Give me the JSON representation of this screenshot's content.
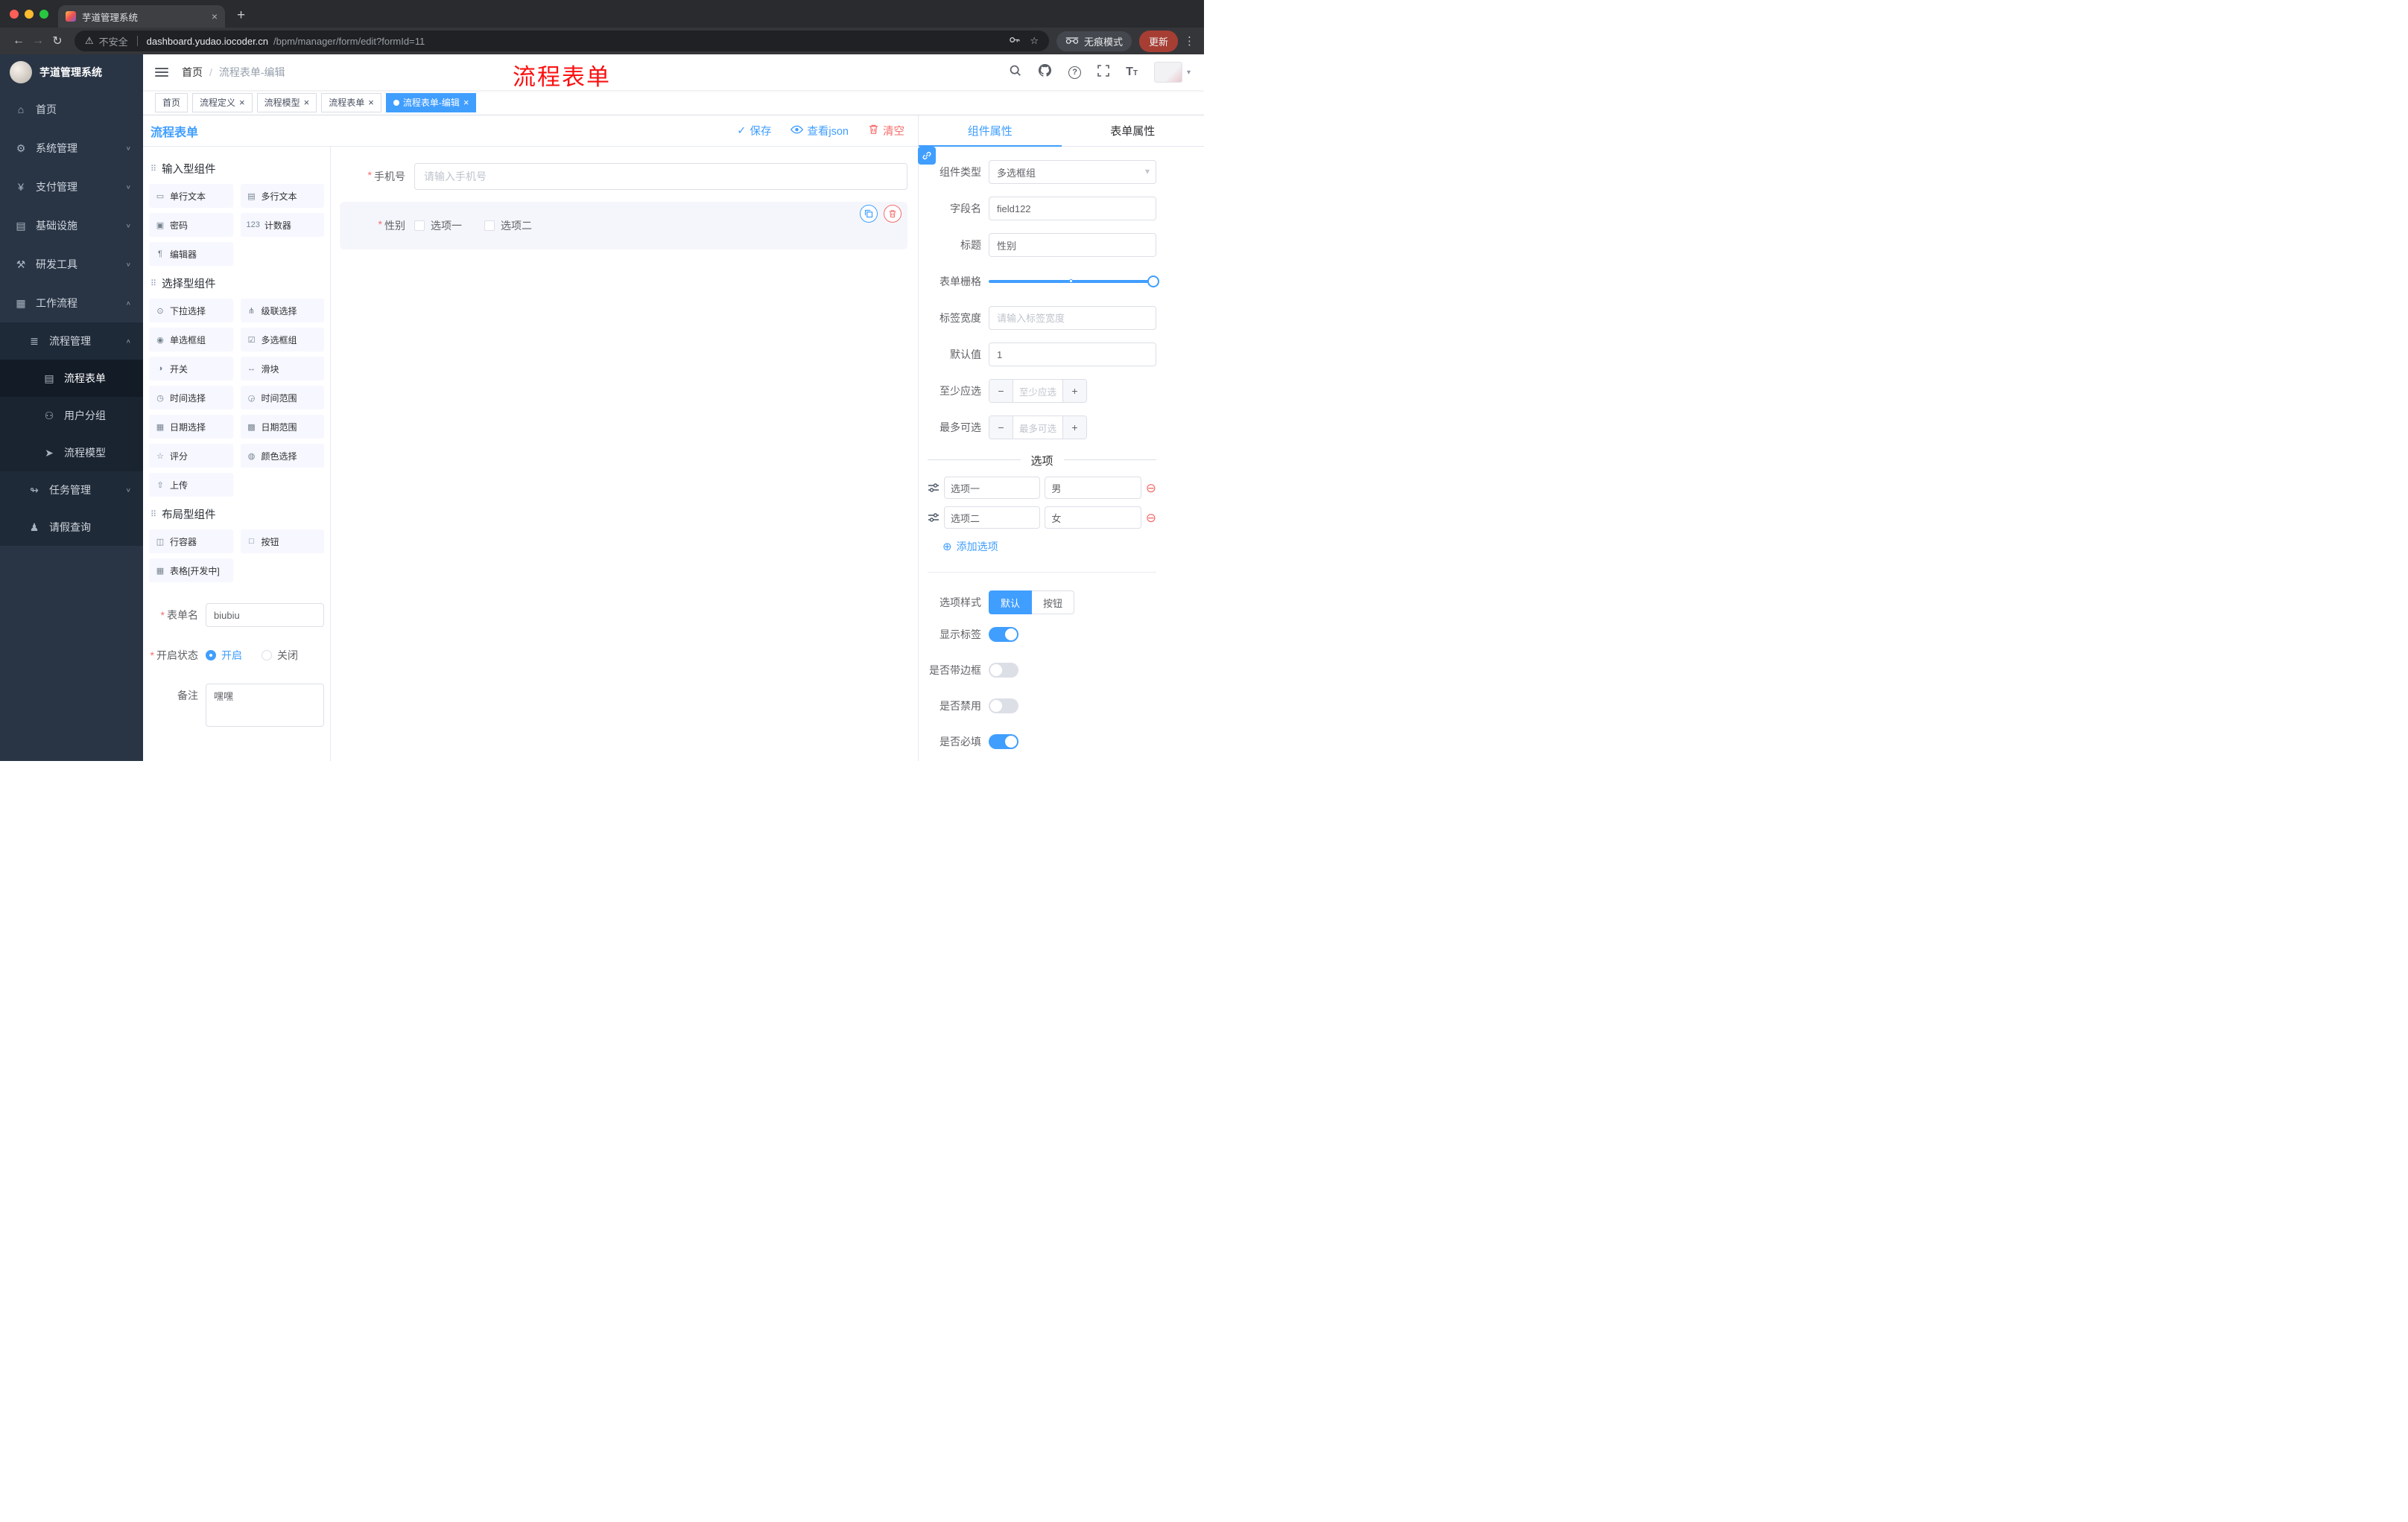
{
  "ui": {
    "required_glyph": "*",
    "close_glyph": "×",
    "caret_down": "▾",
    "check_glyph": "✓",
    "new_tab_glyph": "+",
    "back_glyph": "←",
    "forward_glyph": "→",
    "reload_glyph": "↻",
    "warning_glyph": "⚠",
    "bookmark_star_glyph": "☆",
    "menu_dots_glyph": "⋮",
    "breadcrumb_separator": "/",
    "help_glyph": "?",
    "font_size_glyph_large": "T",
    "font_size_glyph_small": "T",
    "stepper_minus_glyph": "−",
    "stepper_plus_glyph": "+",
    "add_circle_glyph": "⊕",
    "remove_circle_glyph": "⊖",
    "group_drag_glyph": "⠿"
  },
  "colors": {
    "primary": "#409EFF",
    "danger": "#F56C6C",
    "annotation_red": "#FB1010",
    "active_tag": "#409EFF",
    "sidebar_bg": "#293545"
  },
  "browser": {
    "tab_title": "芋道管理系统",
    "security_warning": "不安全",
    "url_host": "dashboard.yudao.iocoder.cn",
    "url_path": "/bpm/manager/form/edit?formId=11",
    "incognito_label": "无痕模式",
    "update_label": "更新"
  },
  "sidebar": {
    "logo_title": "芋道管理系统",
    "items": [
      {
        "label": "首页",
        "glyph": "⌂",
        "arrow": ""
      },
      {
        "label": "系统管理",
        "glyph": "⚙",
        "arrow": "∨"
      },
      {
        "label": "支付管理",
        "glyph": "¥",
        "arrow": "∨"
      },
      {
        "label": "基础设施",
        "glyph": "▤",
        "arrow": "∨"
      },
      {
        "label": "研发工具",
        "glyph": "⚒",
        "arrow": "∨"
      },
      {
        "label": "工作流程",
        "glyph": "▦",
        "arrow": "∧"
      }
    ],
    "process_mgmt": {
      "label": "流程管理",
      "glyph": "≣",
      "arrow": "∧"
    },
    "process_children": [
      {
        "label": "流程表单",
        "glyph": "▤",
        "active": true
      },
      {
        "label": "用户分组",
        "glyph": "⚇",
        "active": false
      },
      {
        "label": "流程模型",
        "glyph": "➤",
        "active": false
      }
    ],
    "task_mgmt": {
      "label": "任务管理",
      "glyph": "↬",
      "arrow": "∨"
    },
    "leave_query": {
      "label": "请假查询",
      "glyph": "♟"
    }
  },
  "navbar": {
    "breadcrumb_home": "首页",
    "breadcrumb_current": "流程表单-编辑",
    "overlay_title": "流程表单"
  },
  "tags": [
    {
      "label": "首页",
      "closable": false,
      "active": false
    },
    {
      "label": "流程定义",
      "closable": true,
      "active": false
    },
    {
      "label": "流程模型",
      "closable": true,
      "active": false
    },
    {
      "label": "流程表单",
      "closable": true,
      "active": false
    },
    {
      "label": "流程表单-编辑",
      "closable": true,
      "active": true
    }
  ],
  "designer": {
    "title": "流程表单",
    "save_label": "保存",
    "view_json_label": "查看json",
    "clear_label": "清空",
    "groups": [
      {
        "title": "输入型组件",
        "items": [
          {
            "label": "单行文本",
            "glyph": "▭"
          },
          {
            "label": "多行文本",
            "glyph": "▤"
          },
          {
            "label": "密码",
            "glyph": "▣"
          },
          {
            "label": "计数器",
            "glyph": "123"
          },
          {
            "label": "编辑器",
            "glyph": "¶"
          }
        ]
      },
      {
        "title": "选择型组件",
        "items": [
          {
            "label": "下拉选择",
            "glyph": "⊙"
          },
          {
            "label": "级联选择",
            "glyph": "⋔"
          },
          {
            "label": "单选框组",
            "glyph": "◉"
          },
          {
            "label": "多选框组",
            "glyph": "☑"
          },
          {
            "label": "开关",
            "glyph": "◑"
          },
          {
            "label": "滑块",
            "glyph": "↔"
          },
          {
            "label": "时间选择",
            "glyph": "◷"
          },
          {
            "label": "时间范围",
            "glyph": "◶"
          },
          {
            "label": "日期选择",
            "glyph": "▦"
          },
          {
            "label": "日期范围",
            "glyph": "▩"
          },
          {
            "label": "评分",
            "glyph": "☆"
          },
          {
            "label": "颜色选择",
            "glyph": "◍"
          },
          {
            "label": "上传",
            "glyph": "⇧"
          }
        ]
      },
      {
        "title": "布局型组件",
        "items": [
          {
            "label": "行容器",
            "glyph": "◫"
          },
          {
            "label": "按钮",
            "glyph": "□"
          },
          {
            "label": "表格[开发中]",
            "glyph": "▦"
          }
        ]
      }
    ],
    "meta": {
      "form_name_label": "表单名",
      "form_name_value": "biubiu",
      "status_label": "开启状态",
      "status_on": "开启",
      "status_off": "关闭",
      "status_selected": "开启",
      "remark_label": "备注",
      "remark_value": "嘿嘿"
    },
    "canvas": {
      "phone_label": "手机号",
      "phone_placeholder": "请输入手机号",
      "gender_label": "性别",
      "gender_option1": "选项一",
      "gender_option2": "选项二"
    }
  },
  "properties": {
    "tab_component": "组件属性",
    "tab_form": "表单属性",
    "active_tab": "组件属性",
    "rows": {
      "type_label": "组件类型",
      "type_value": "多选框组",
      "field_label": "字段名",
      "field_value": "field122",
      "title_label": "标题",
      "title_value": "性别",
      "grid_label": "表单栅格",
      "label_width_label": "标签宽度",
      "label_width_placeholder": "请输入标签宽度",
      "default_label": "默认值",
      "default_value": "1",
      "min_label": "至少应选",
      "min_placeholder": "至少应选",
      "max_label": "最多可选",
      "max_placeholder": "最多可选"
    },
    "options_divider": "选项",
    "options": [
      {
        "name": "选项一",
        "value": "男"
      },
      {
        "name": "选项二",
        "value": "女"
      }
    ],
    "add_option_label": "添加选项",
    "style_label": "选项样式",
    "style_default": "默认",
    "style_button": "按钮",
    "style_selected": "默认",
    "toggles": [
      {
        "label": "显示标签",
        "on": true
      },
      {
        "label": "是否带边框",
        "on": false
      },
      {
        "label": "是否禁用",
        "on": false
      },
      {
        "label": "是否必填",
        "on": true
      }
    ]
  }
}
